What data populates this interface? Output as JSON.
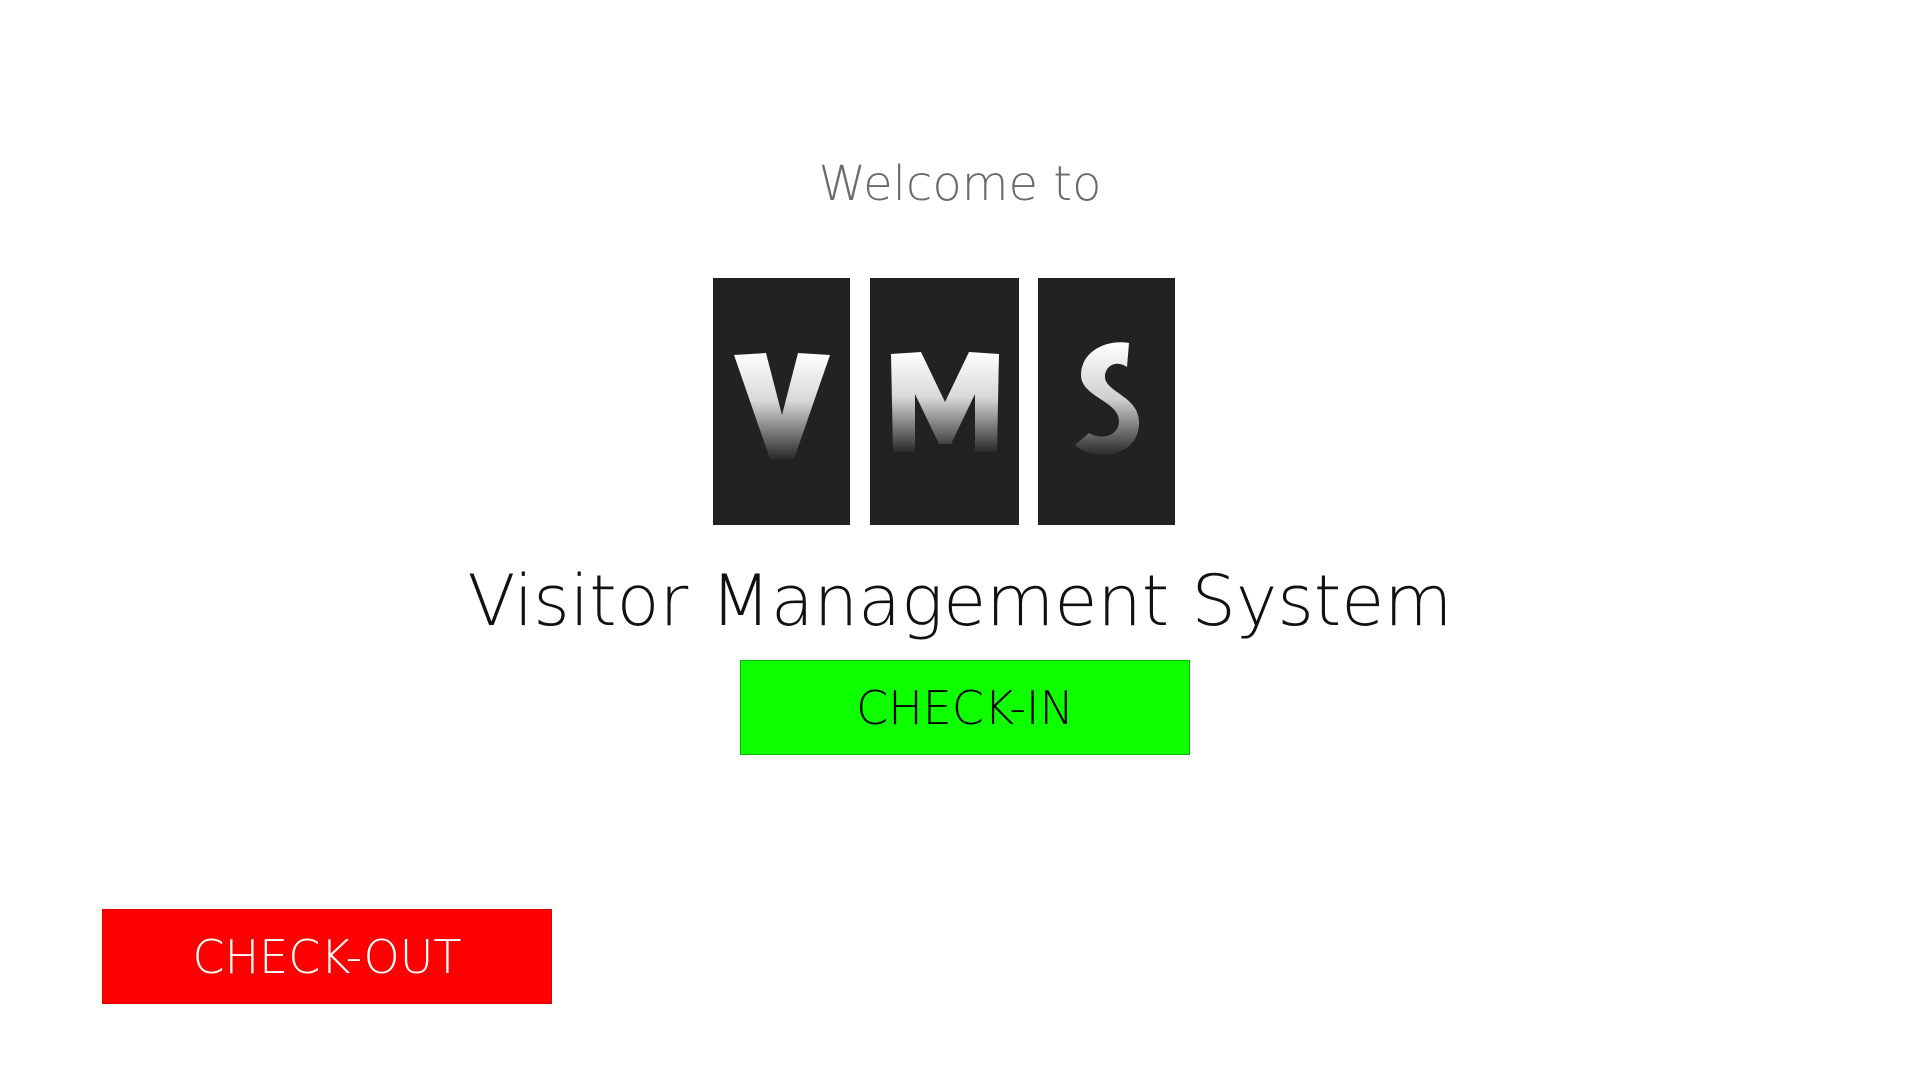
{
  "welcome_text": "Welcome to",
  "logo": {
    "letters": [
      "V",
      "M",
      "S"
    ],
    "tile_color": "#222222",
    "letter_gradient": [
      "#ffffff",
      "#2a2a2a"
    ]
  },
  "app_title": "Visitor Management System",
  "checkin_button": {
    "label": "CHECK-IN",
    "color": "#0dff00"
  },
  "checkout_button": {
    "label": "CHECK-OUT",
    "color": "#ff0000"
  }
}
